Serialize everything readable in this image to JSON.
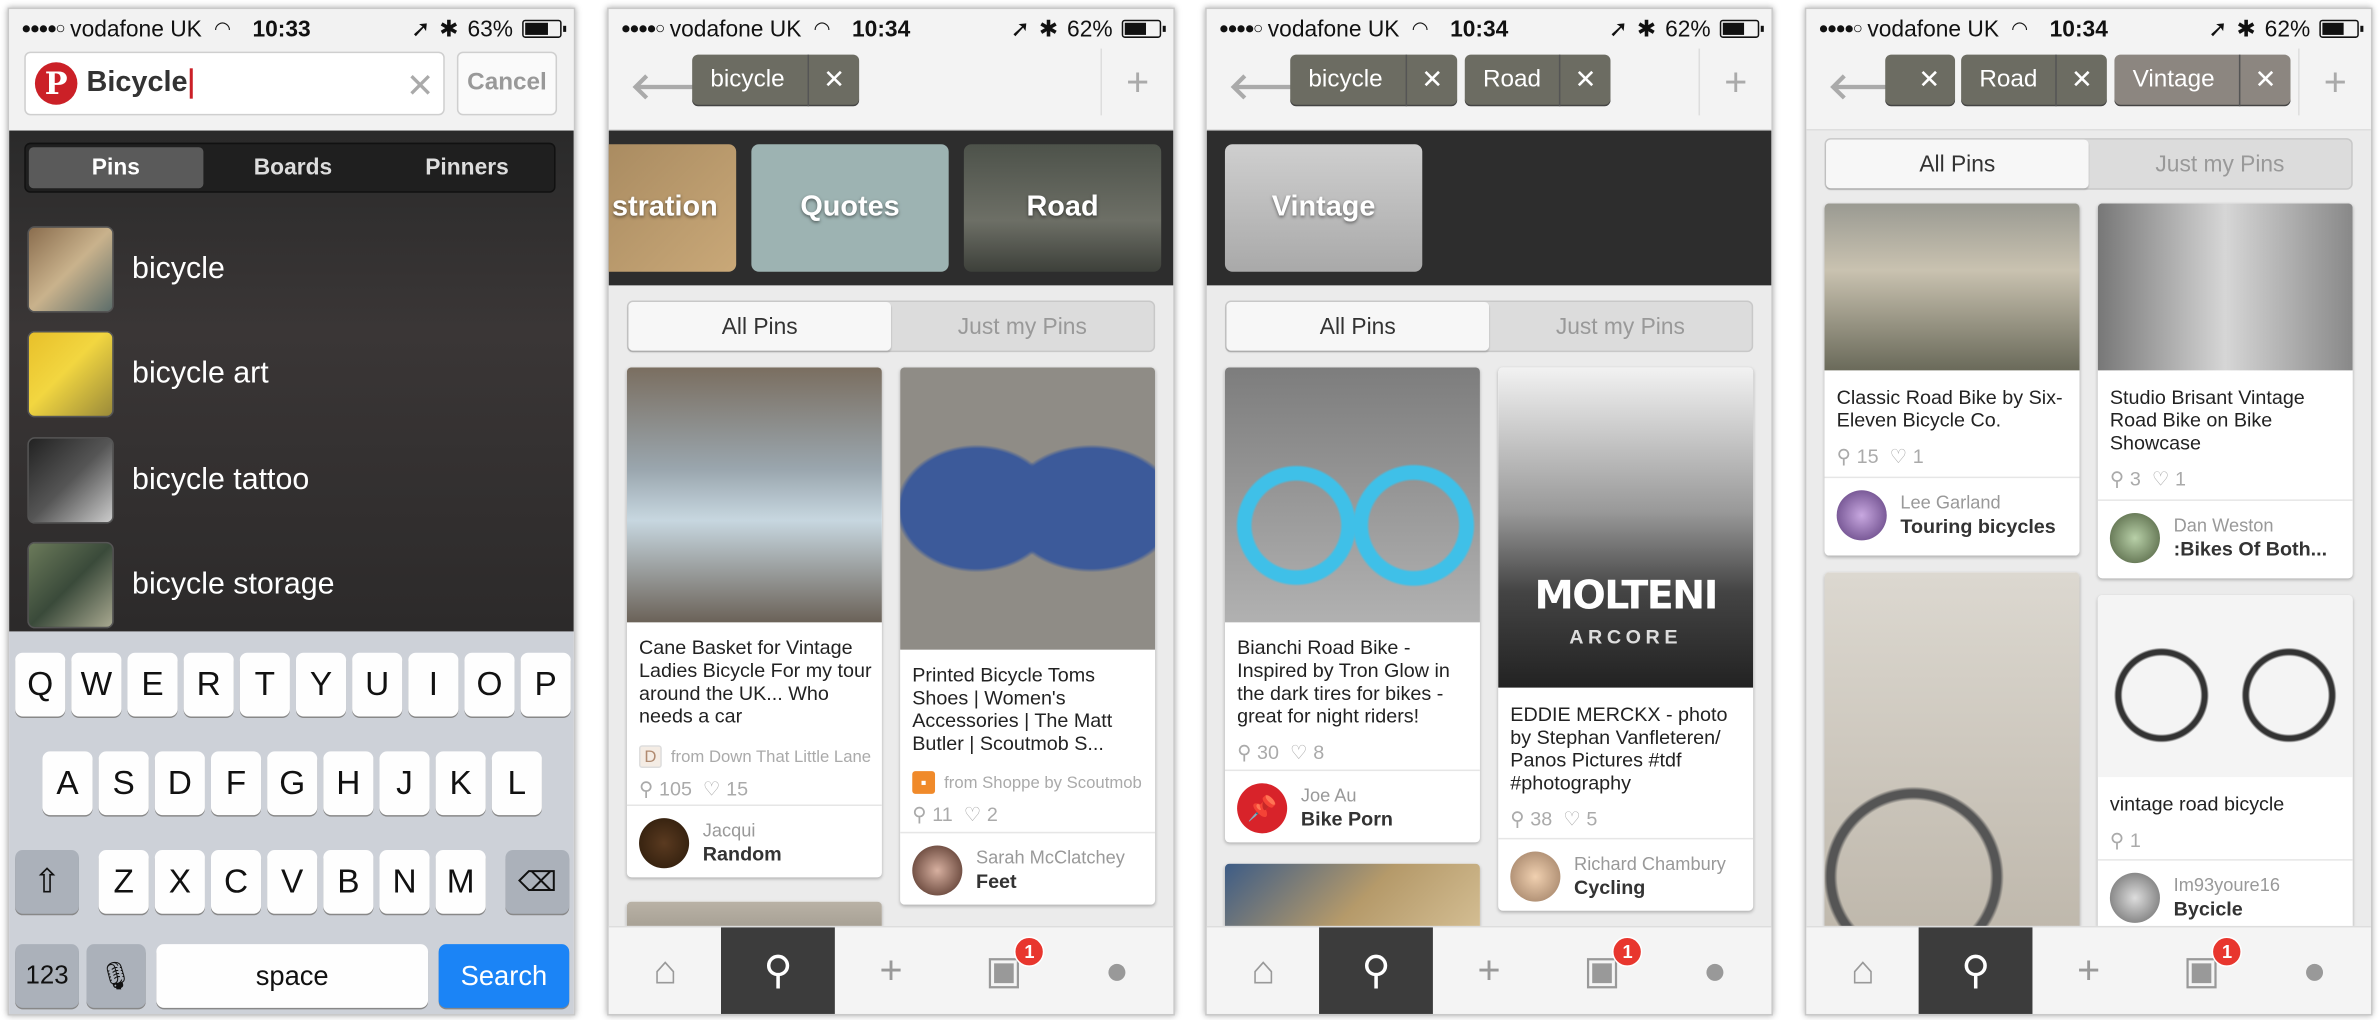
{
  "status_bars": [
    {
      "carrier": "vodafone UK",
      "time": "10:33",
      "battery": "63%"
    },
    {
      "carrier": "vodafone UK",
      "time": "10:34",
      "battery": "62%"
    },
    {
      "carrier": "vodafone UK",
      "time": "10:34",
      "battery": "62%"
    },
    {
      "carrier": "vodafone UK",
      "time": "10:34",
      "battery": "62%"
    }
  ],
  "screen1": {
    "search_value": "Bicycle",
    "cancel_label": "Cancel",
    "scope_tabs": [
      "Pins",
      "Boards",
      "Pinners"
    ],
    "suggestions": [
      "bicycle",
      "bicycle art",
      "bicycle tattoo",
      "bicycle storage"
    ],
    "keyboard": {
      "row1": [
        "Q",
        "W",
        "E",
        "R",
        "T",
        "Y",
        "U",
        "I",
        "O",
        "P"
      ],
      "row2": [
        "A",
        "S",
        "D",
        "F",
        "G",
        "H",
        "J",
        "K",
        "L"
      ],
      "row3": [
        "Z",
        "X",
        "C",
        "V",
        "B",
        "N",
        "M"
      ],
      "num_label": "123",
      "space_label": "space",
      "search_label": "Search"
    }
  },
  "screen2": {
    "tags": [
      "bicycle"
    ],
    "categories": [
      "stration",
      "Quotes",
      "Road"
    ],
    "filter_tabs": [
      "All Pins",
      "Just my Pins"
    ],
    "pins": [
      {
        "title": "Cane Basket for Vintage Ladies Bicycle For my tour around the UK... Who needs a car",
        "source": "from Down That Little Lane",
        "repins": "105",
        "likes": "15",
        "user": "Jacqui",
        "board": "Random"
      },
      {
        "title": "Printed Bicycle Toms Shoes | Women's Accessories | The Matt Butler | Scoutmob S...",
        "source": "from Shoppe by Scoutmob",
        "repins": "11",
        "likes": "2",
        "user": "Sarah McClatchey",
        "board": "Feet"
      }
    ]
  },
  "screen3": {
    "tags": [
      "bicycle",
      "Road"
    ],
    "categories": [
      "Vintage"
    ],
    "filter_tabs": [
      "All Pins",
      "Just my Pins"
    ],
    "pins": [
      {
        "title": "Bianchi Road Bike - Inspired by Tron  Glow in the dark  tires for bikes - great for night riders!",
        "repins": "30",
        "likes": "8",
        "user": "Joe Au",
        "board": "Bike Porn"
      },
      {
        "title": "EDDIE MERCKX - photo by Stephan Vanfleteren/ Panos Pictures #tdf #photography",
        "repins": "38",
        "likes": "5",
        "user": "Richard Chambury",
        "board": "Cycling",
        "image_text": "MOLTENI",
        "image_text2": "ARCORE"
      }
    ]
  },
  "screen4": {
    "tags": [
      "Road",
      "Vintage"
    ],
    "filter_tabs": [
      "All Pins",
      "Just my Pins"
    ],
    "pins": [
      {
        "title": "Classic Road Bike by Six-Eleven Bicycle Co.",
        "repins": "15",
        "likes": "1",
        "user": "Lee Garland",
        "board": "Touring bicycles"
      },
      {
        "title": "Studio Brisant Vintage Road Bike on Bike Showcase",
        "repins": "3",
        "likes": "1",
        "user": "Dan Weston",
        "board": ":Bikes Of Both..."
      },
      {
        "title": "vintage road bicycle",
        "repins": "1",
        "user": "Im93youre16",
        "board": "Bycicle"
      }
    ]
  },
  "tabbar": {
    "badge": "1"
  },
  "colors": {
    "pinterest_red": "#cb2027",
    "badge_red": "#e8362e",
    "ios_blue": "#1b84f6",
    "dark_strip": "#2d2d2d",
    "tag_bg": "#6c6c62"
  },
  "icons": [
    "pinterest-logo-icon",
    "home-icon",
    "search-icon",
    "plus-icon",
    "notifications-icon",
    "profile-icon",
    "back-arrow-icon",
    "close-icon",
    "repin-icon",
    "heart-icon",
    "microphone-icon",
    "shift-icon",
    "delete-icon"
  ]
}
